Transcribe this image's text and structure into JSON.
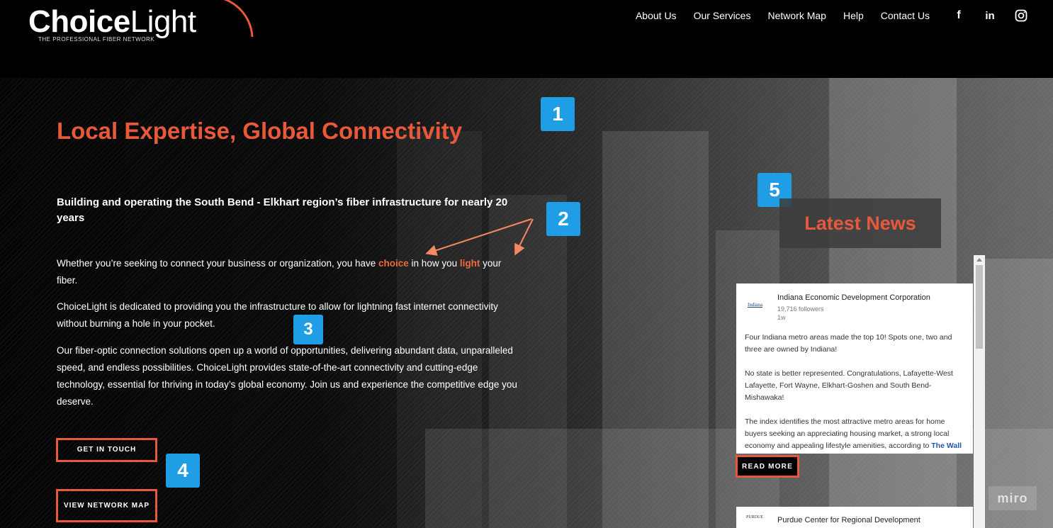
{
  "brand": {
    "name_bold": "Choice",
    "name_light": "Light",
    "tagline": "THE PROFESSIONAL FIBER NETWORK",
    "accent_color": "#e8593b"
  },
  "nav": {
    "items": [
      "About Us",
      "Our Services",
      "Network Map",
      "Help",
      "Contact Us"
    ],
    "social": [
      {
        "icon": "facebook-icon",
        "glyph": "f"
      },
      {
        "icon": "linkedin-icon",
        "glyph": "in"
      },
      {
        "icon": "instagram-icon",
        "glyph": ""
      }
    ]
  },
  "hero": {
    "title": "Local Expertise, Global Connectivity",
    "subtitle": "Building and operating the South Bend - Elkhart region’s fiber infrastructure for nearly 20 years",
    "p1_before": "Whether you’re seeking to connect your business or organization, you have ",
    "p1_choice": "choice",
    "p1_middle": " in how you ",
    "p1_light": "light",
    "p1_after": " your fiber.",
    "p2": "ChoiceLight is dedicated to providing you the infrastructure to allow for lightning fast internet connectivity without burning a hole in your pocket.",
    "p3": "Our fiber-optic connection solutions open up a world of opportunities, delivering abundant data, unparalleled speed, and endless possibilities. ChoiceLight provides state-of-the-art connectivity and cutting-edge technology, essential for thriving in today’s global economy. Join us and experience the competitive edge you deserve.",
    "btn_touch": "GET IN TOUCH",
    "btn_map": "VIEW NETWORK MAP"
  },
  "markers": [
    "1",
    "2",
    "3",
    "4",
    "5"
  ],
  "news": {
    "title": "Latest News",
    "post1": {
      "logo_text": "Indiana",
      "org": "Indiana Economic Development Corporation",
      "followers": "19,716 followers",
      "age": "1w",
      "para1": "Four Indiana metro areas made the top 10! Spots one, two and three are owned by Indiana!",
      "para2": "No state is better represented. Congratulations, Lafayette-West Lafayette, Fort Wayne, Elkhart-Goshen and South Bend-Mishawaka!",
      "para3": "The index identifies the most attractive metro areas for home buyers seeking an appreciating housing market, a strong local economy and appealing lifestyle amenities, according to ",
      "link": "The Wall Street Journal",
      "read_more": "READ MORE"
    },
    "post2": {
      "logo_text": "PURDUE",
      "org": "Purdue Center for Regional Development"
    }
  },
  "watermark": "miro"
}
